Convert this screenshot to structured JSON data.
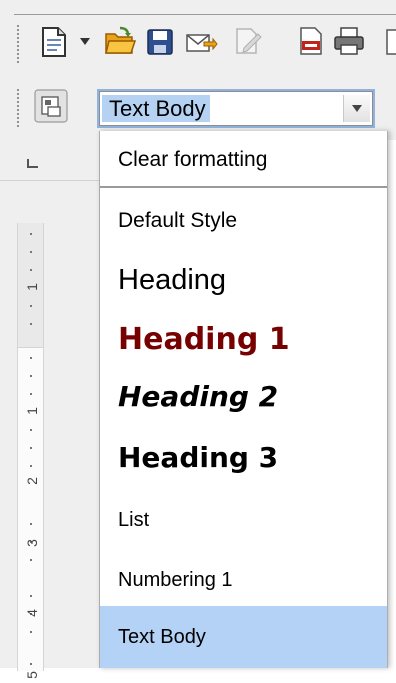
{
  "toolbar": {
    "icons": [
      "new-document-icon",
      "dropdown-arrow-icon",
      "open-folder-icon",
      "save-icon",
      "email-icon",
      "edit-file-icon",
      "export-pdf-icon",
      "print-icon"
    ],
    "styles_icon": "styles-formatting-icon"
  },
  "style_box": {
    "current_value": "Text Body"
  },
  "ruler": {
    "numbers": [
      "1",
      "1",
      "2",
      "3",
      "4",
      "5"
    ]
  },
  "dropdown": {
    "items": [
      {
        "label": "Clear formatting"
      },
      {
        "label": "Default Style"
      },
      {
        "label": "Heading"
      },
      {
        "label": "Heading 1"
      },
      {
        "label": "Heading 2"
      },
      {
        "label": "Heading 3"
      },
      {
        "label": "List"
      },
      {
        "label": "Numbering 1"
      },
      {
        "label": "Text Body"
      }
    ],
    "selected": "Text Body"
  },
  "colors": {
    "selection": "#b4d2f5",
    "heading1": "#770000",
    "focus_ring": "#8fb3de"
  }
}
